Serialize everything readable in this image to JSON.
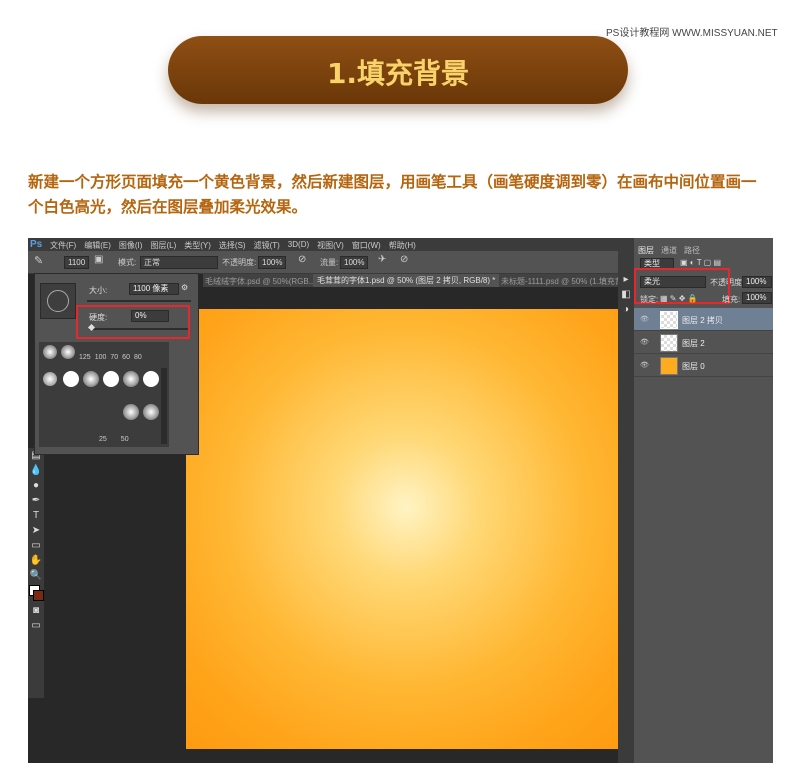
{
  "watermark": "PS设计教程网 WWW.MISSYUAN.NET",
  "banner": {
    "title": "1.填充背景"
  },
  "intro": "新建一个方形页面填充一个黄色背景，然后新建图层，用画笔工具（画笔硬度调到零）在画布中间位置画一个白色高光，然后在图层叠加柔光效果。",
  "ps": {
    "logo": "Ps",
    "menu": [
      "文件(F)",
      "编辑(E)",
      "图像(I)",
      "图层(L)",
      "类型(Y)",
      "选择(S)",
      "滤镜(T)",
      "3D(D)",
      "视图(V)",
      "窗口(W)",
      "帮助(H)"
    ],
    "options": {
      "brush_size": "1100",
      "mode_label": "模式:",
      "mode_value": "正常",
      "opacity_label": "不透明度:",
      "opacity_value": "100%",
      "flow_label": "流量:",
      "flow_value": "100%"
    },
    "doc_tabs": [
      "毛绒绒字体.psd @ 50%(RGB...",
      "毛茸茸的字体1.psd @ 50% (图层 2 拷贝, RGB/8) *",
      "未标题-1111.psd @ 50% (1.填充背"
    ],
    "brush_panel": {
      "size_label": "大小:",
      "size_value": "1100 像素",
      "hardness_label": "硬度:",
      "hardness_value": "0%",
      "preset_sizes": [
        "125",
        "100",
        "70",
        "60",
        "80"
      ],
      "bottom_sizes": [
        "25",
        "50"
      ]
    },
    "tools": [
      "gradient-tool",
      "blur-tool",
      "dodge-tool",
      "pen-tool",
      "type-tool",
      "path-select-tool",
      "shape-tool",
      "hand-tool",
      "zoom-tool"
    ],
    "layers_panel": {
      "tabs": [
        "图层",
        "通道",
        "路径"
      ],
      "kind_label": "类型",
      "blend_mode": "柔光",
      "opacity_label": "不透明度:",
      "opacity_value": "100%",
      "lock_label": "锁定:",
      "fill_label": "填充:",
      "fill_value": "100%",
      "layers": [
        {
          "name": "图层 2 拷贝",
          "selected": true,
          "thumb": "transparent"
        },
        {
          "name": "图层 2",
          "selected": false,
          "thumb": "transparent"
        },
        {
          "name": "图层 0",
          "selected": false,
          "thumb": "#ffab1f"
        }
      ]
    }
  },
  "colors": {
    "accent": "#b5650e",
    "banner": "#7a4010",
    "banner_text": "#f8d36a",
    "highlight_box": "#e8262e",
    "canvas": "#ffa41a"
  }
}
